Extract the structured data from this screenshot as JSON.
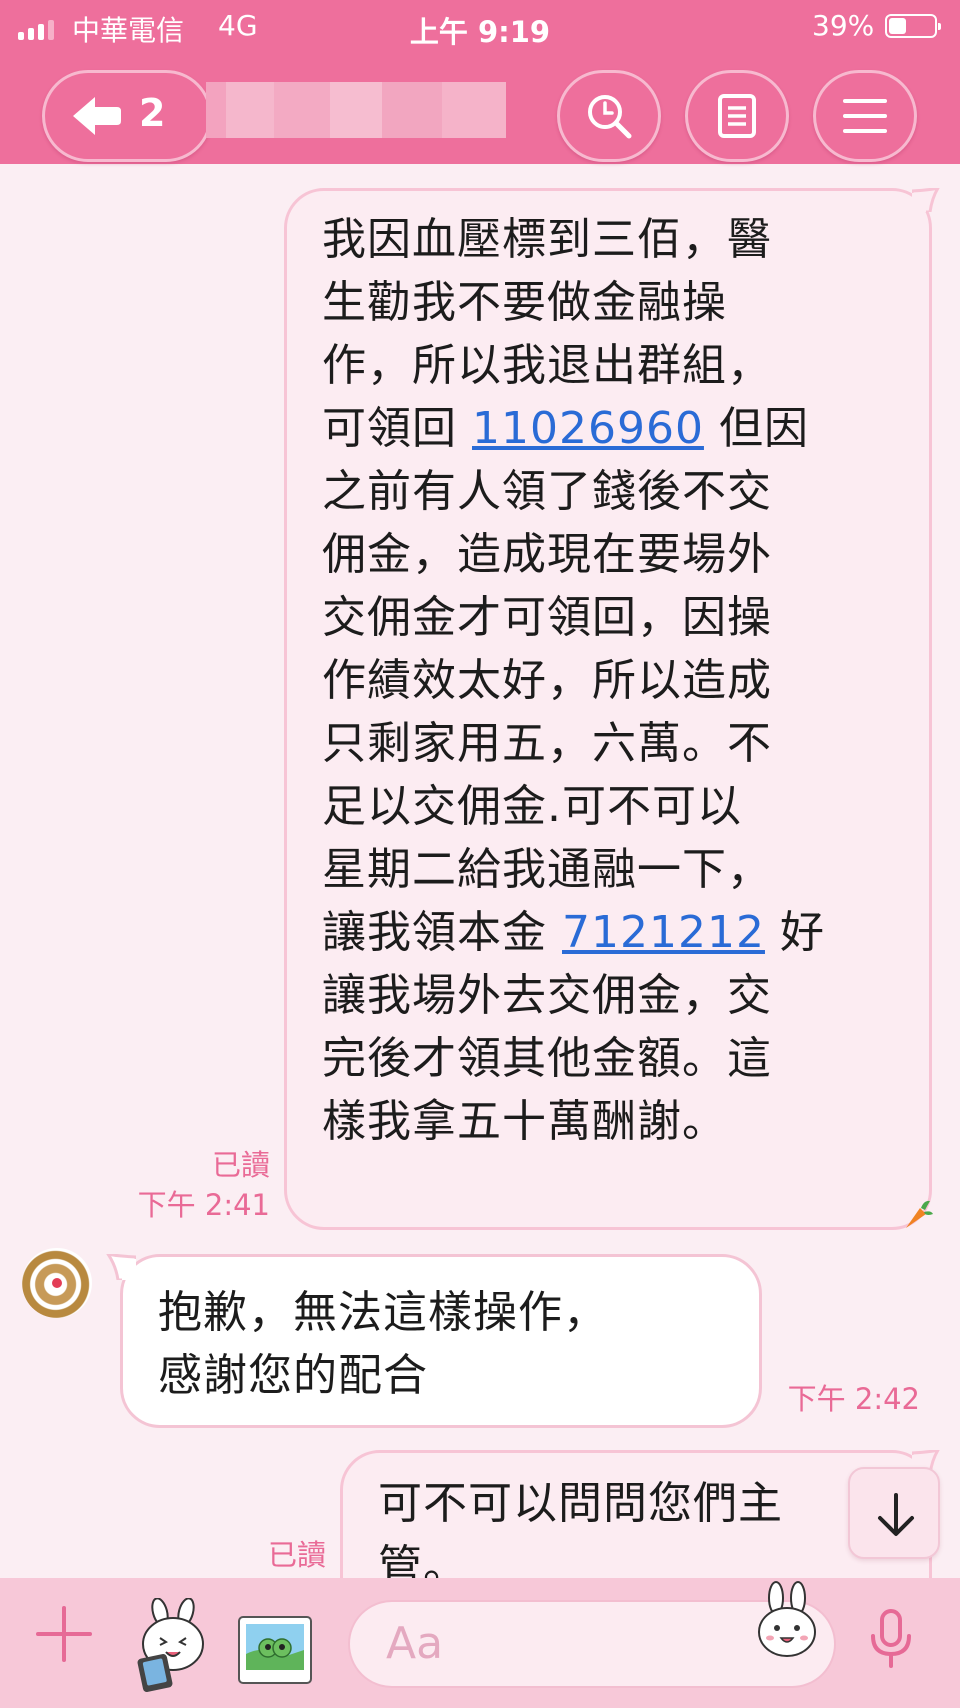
{
  "status_bar": {
    "carrier": "中華電信",
    "network": "4G",
    "time": "上午 9:19",
    "battery": "39%",
    "battery_level": 0.39
  },
  "header": {
    "back_count": "2",
    "chat_name": "",
    "search_icon": "search-icon",
    "notes_icon": "note-icon",
    "menu_icon": "menu-icon"
  },
  "messages": [
    {
      "direction": "outgoing",
      "lines": [
        "我因血壓標到三佰，醫",
        "生勸我不要做金融操",
        "作，所以我退出群組，",
        "可領回 ",
        "之前有人領了錢後不交",
        "佣金，造成現在要場外",
        "交佣金才可領回，因操",
        "作績效太好，所以造成",
        "只剩家用五，六萬。不",
        "足以交佣金.可不可以",
        "星期二給我通融一下，",
        "讓我領本金 ",
        "讓我場外去交佣金，交",
        "完後才領其他金額。這",
        "樣我拿五十萬酬謝。"
      ],
      "link_1": "11026960",
      "after_link_1": " 但因",
      "link_2": "7121212",
      "after_link_2": " 好",
      "read": "已讀",
      "time": "下午 2:41"
    },
    {
      "direction": "incoming",
      "lines": [
        "抱歉，無法這樣操作，",
        "感謝您的配合"
      ],
      "time": "下午 2:42"
    },
    {
      "direction": "outgoing",
      "lines": [
        "可不可以問問您們主",
        "管。"
      ],
      "read": "已讀"
    }
  ],
  "input_bar": {
    "placeholder": "Aa"
  },
  "colors": {
    "header": "#ee6f9c",
    "background": "#fbeef3",
    "meta_text": "#e96a96",
    "link": "#2a6bd6"
  }
}
